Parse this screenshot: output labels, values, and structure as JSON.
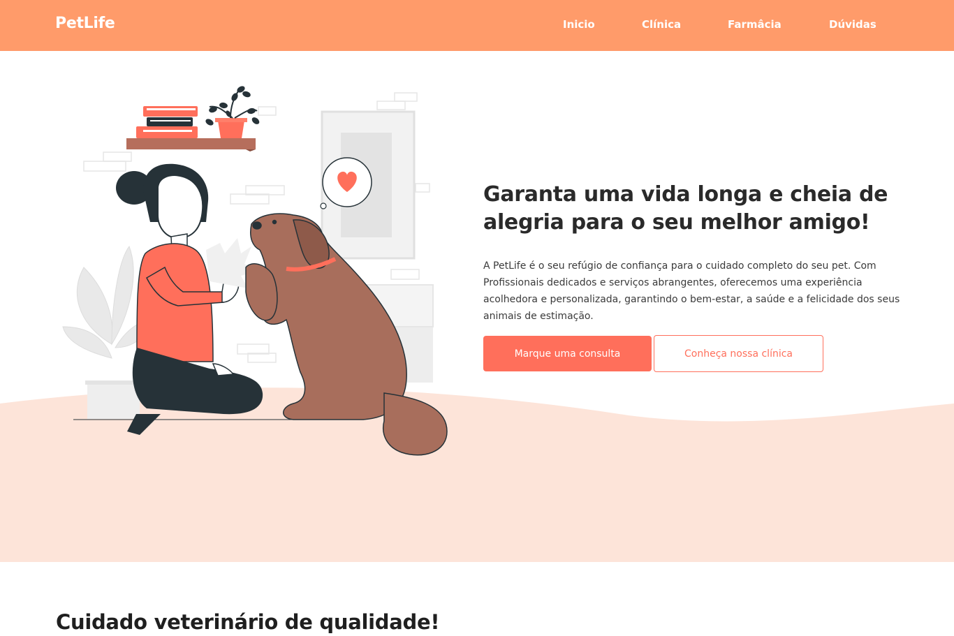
{
  "navbar": {
    "logo": "PetLife",
    "links": [
      "Inicio",
      "Clínica",
      "Farmâcia",
      "Dúvidas"
    ]
  },
  "hero": {
    "title": "Garanta uma vida longa e cheia de alegria para o seu melhor amigo!",
    "description": "A PetLife é o seu refúgio de confiança para o cuidado completo do seu pet. Com Profissionais dedicados e serviços abrangentes, oferecemos uma experiência acolhedora e personalizada, garantindo o bem-estar, a saúde e a felicidade dos seus animais de estimação.",
    "primary_button": "Marque uma consulta",
    "secondary_button": "Conheça nossa clínica",
    "illustration": "woman-high-five-dog-illustration"
  },
  "section": {
    "title": "Cuidado veterinário de qualidade!"
  },
  "colors": {
    "navbar": "#ff9b6a",
    "accent": "#ff6f5b",
    "hero_wave": "#fde4d9",
    "dog": "#a86e5c"
  }
}
